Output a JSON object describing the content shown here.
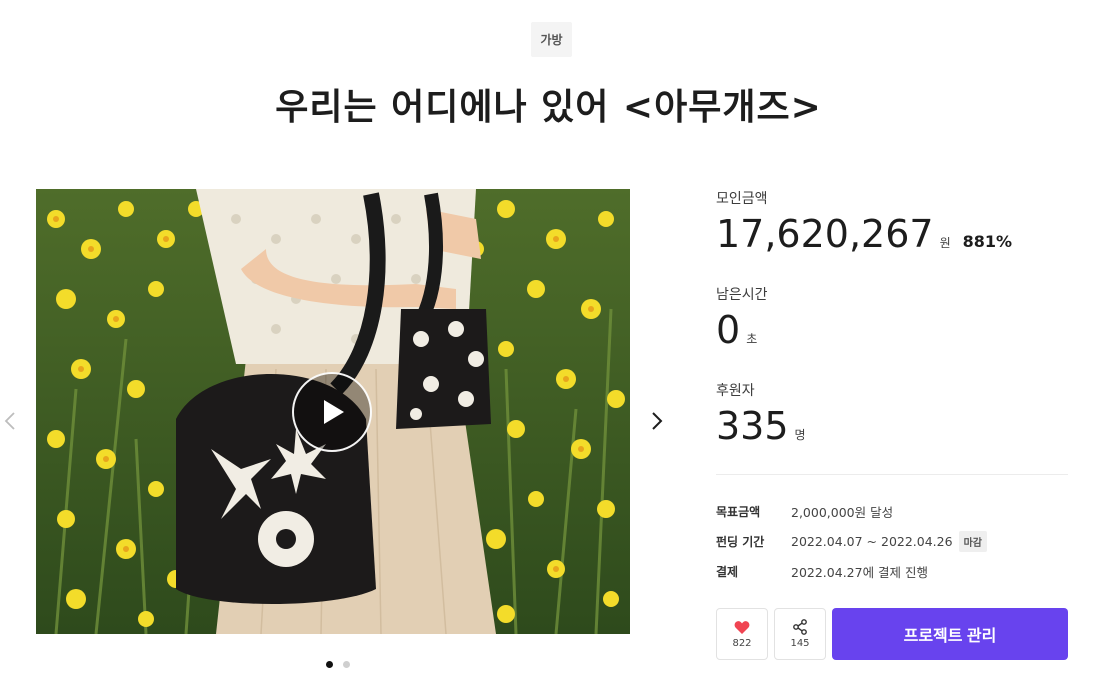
{
  "category": "가방",
  "title": "우리는 어디에나 있어 <아무개즈>",
  "media": {
    "play_icon": "play-icon",
    "prev_icon": "chevron-left-icon",
    "next_icon": "chevron-right-icon",
    "slide_count": 2,
    "active_slide": 1
  },
  "funding": {
    "raised_label": "모인금액",
    "raised_amount": "17,620,267",
    "raised_unit": "원",
    "percent": "881%",
    "time_label": "남은시간",
    "time_value": "0",
    "time_unit": "초",
    "backers_label": "후원자",
    "backers_value": "335",
    "backers_unit": "명"
  },
  "details": {
    "goal_key": "목표금액",
    "goal_value": "2,000,000원 달성",
    "period_key": "펀딩 기간",
    "period_value": "2022.04.07 ~ 2022.04.26",
    "period_badge": "마감",
    "payment_key": "결제",
    "payment_value": "2022.04.27에 결제 진행"
  },
  "actions": {
    "like_count": "822",
    "share_count": "145",
    "manage_label": "프로젝트 관리"
  },
  "colors": {
    "primary": "#6843ee",
    "heart": "#f04452"
  }
}
